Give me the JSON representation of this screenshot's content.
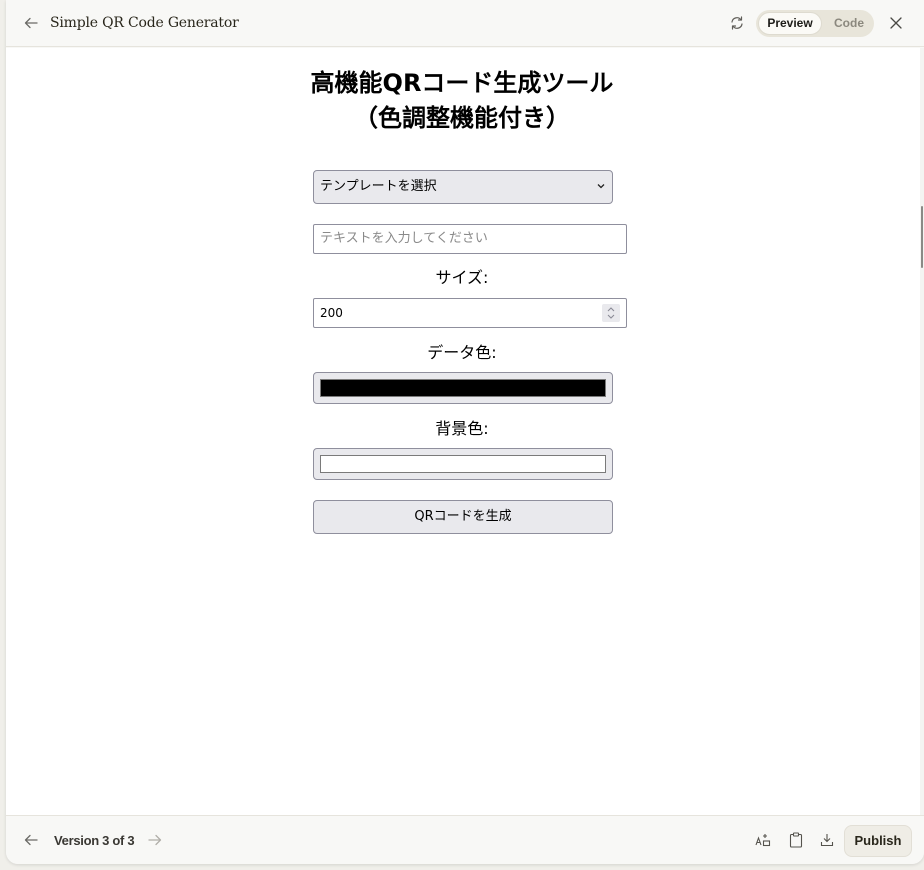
{
  "topbar": {
    "title": "Simple QR Code Generator",
    "back_icon": "arrow-left-icon",
    "refresh_icon": "refresh-icon",
    "toggle": {
      "preview_label": "Preview",
      "code_label": "Code",
      "selected": "Preview"
    },
    "close_icon": "close-icon"
  },
  "app": {
    "title_line1": "高機能QRコード生成ツール",
    "title_line2": "（色調整機能付き）",
    "template_select": {
      "selected": "テンプレートを選択",
      "chevron": "⌄"
    },
    "text_input": {
      "value": "",
      "placeholder": "テキストを入力してください"
    },
    "size_label": "サイズ:",
    "size_value": "200",
    "data_color_label": "データ色:",
    "data_color": "#000000",
    "bg_color_label": "背景色:",
    "bg_color": "#ffffff",
    "generate_button": "QRコードを生成"
  },
  "footer": {
    "version_text": "Version 3 of 3",
    "prev_icon": "arrow-left-icon",
    "next_icon": "arrow-right-icon",
    "icons": [
      "translate-icon",
      "clipboard-icon",
      "download-icon"
    ],
    "publish_label": "Publish"
  }
}
